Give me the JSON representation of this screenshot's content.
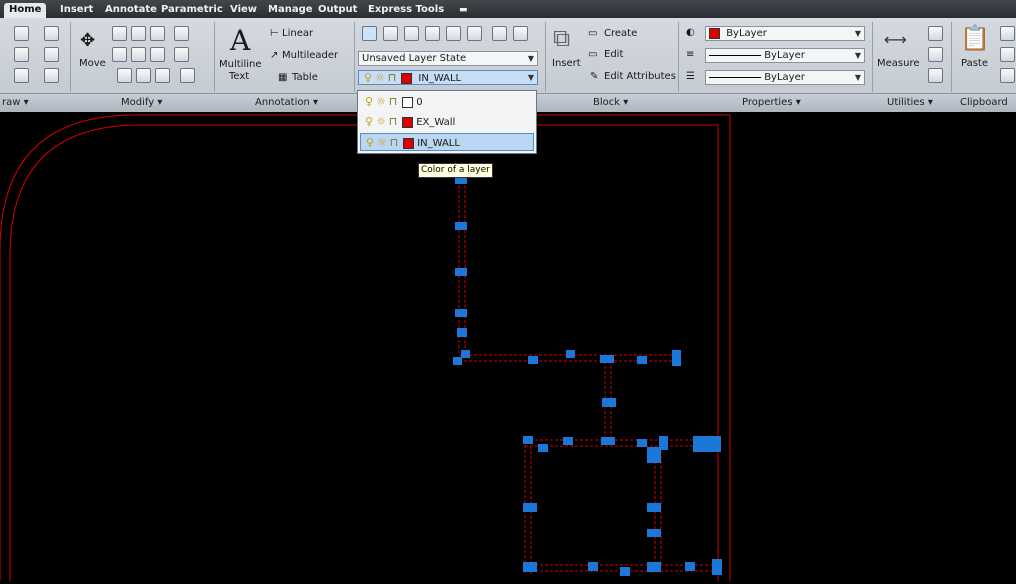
{
  "tabs": [
    "Home",
    "Insert",
    "Annotate",
    "Parametric",
    "View",
    "Manage",
    "Output",
    "Express Tools"
  ],
  "panels": {
    "draw": "raw ▾",
    "modify": "Modify ▾",
    "annotation": "Annotation ▾",
    "block": "Block ▾",
    "properties": "Properties ▾",
    "utilities": "Utilities ▾",
    "clipboard": "Clipboard"
  },
  "modify": {
    "move": "Move"
  },
  "annotation": {
    "multiline_text_1": "Multiline",
    "multiline_text_2": "Text",
    "linear": "Linear",
    "multileader": "Multileader",
    "table": "Table"
  },
  "layers": {
    "state": "Unsaved Layer State",
    "current": "IN_WALL",
    "items": [
      {
        "name": "0",
        "color": "#ffffff"
      },
      {
        "name": "EX_Wall",
        "color": "#e00000"
      },
      {
        "name": "IN_WALL",
        "color": "#e00000"
      }
    ]
  },
  "block": {
    "insert": "Insert",
    "create": "Create",
    "edit": "Edit",
    "edit_attributes": "Edit Attributes"
  },
  "properties": {
    "color": "ByLayer",
    "linetype": "ByLayer",
    "lineweight": "ByLayer"
  },
  "utilities": {
    "measure": "Measure"
  },
  "clipboard": {
    "paste": "Paste"
  },
  "tooltip": "Color of a layer",
  "colors": {
    "accent": "#1b78d8",
    "wall": "#d40000"
  }
}
